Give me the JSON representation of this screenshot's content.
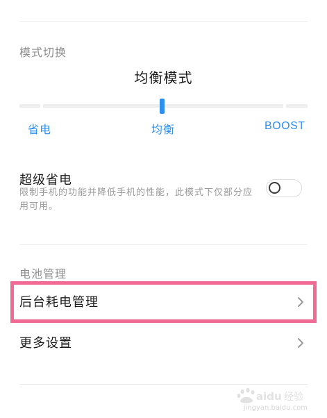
{
  "mode_switch": {
    "section_title": "模式切换",
    "current_mode": "均衡模式",
    "slider": {
      "options": [
        "省电",
        "均衡",
        "BOOST"
      ],
      "selected": "均衡"
    }
  },
  "super_power_saving": {
    "title": "超级省电",
    "description": "限制手机的功能并降低手机的性能，此模式下仅部分应用可用。",
    "enabled": false
  },
  "battery_management": {
    "section_title": "电池管理",
    "items": [
      {
        "label": "后台耗电管理",
        "highlighted": true
      },
      {
        "label": "更多设置",
        "highlighted": false
      }
    ]
  },
  "colors": {
    "accent": "#2d8ff0",
    "highlight_border": "#f06a93",
    "text_primary": "#1b1b1b",
    "text_secondary": "#8e8e8e"
  },
  "icons": {
    "chevron": "chevron-right-icon"
  },
  "watermark": {
    "logo_text": "Baidu经验",
    "sub_text": "jingyan.baidu.com"
  }
}
